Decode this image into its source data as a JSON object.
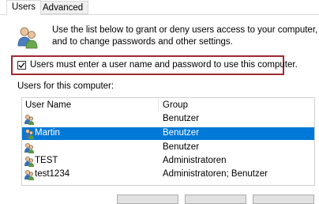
{
  "tabs": [
    {
      "label": "Users"
    },
    {
      "label": "Advanced"
    }
  ],
  "intro": {
    "line1": "Use the list below to grant or deny users access to your computer,",
    "line2": "and to change passwords and other settings."
  },
  "require_login": {
    "label": "Users must enter a user name and password to use this computer.",
    "checked": true
  },
  "users_section": {
    "label": "Users for this computer:",
    "columns": [
      "User Name",
      "Group"
    ],
    "rows": [
      {
        "user": "",
        "group": "Benutzer"
      },
      {
        "user": "Martin",
        "group": "Benutzer",
        "selected": true
      },
      {
        "user": "",
        "group": "Benutzer"
      },
      {
        "user": "TEST",
        "group": "Administratoren"
      },
      {
        "user": "test1234",
        "group": "Administratoren; Benutzer"
      }
    ]
  },
  "colors": {
    "selection": "#0078d7",
    "focus_highlight": "#9d2a33"
  },
  "icons": {
    "header": "users-group-icon",
    "row": "user-icon"
  }
}
